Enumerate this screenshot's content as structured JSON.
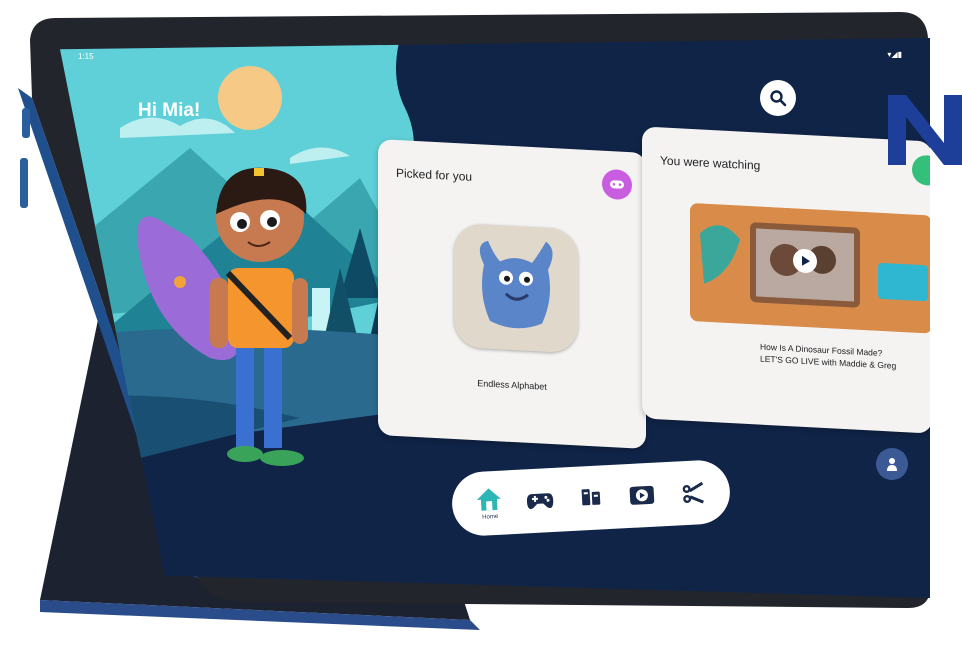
{
  "status_bar": {
    "time": "1:15",
    "icons": "▾◢▮"
  },
  "greeting": "Hi Mia!",
  "search_icon": "search-icon",
  "cards": {
    "picked": {
      "title": "Picked for you",
      "badge_icon": "gamepad-icon",
      "badge_color": "#c95de0",
      "app_name": "Endless Alphabet"
    },
    "watching": {
      "title": "You were watching",
      "badge_color": "#34c07a",
      "video_title_line1": "How Is A Dinosaur Fossil Made?",
      "video_title_line2": "LET'S GO LIVE with Maddie & Greg"
    }
  },
  "nav": {
    "items": [
      {
        "icon": "home-icon",
        "label": "Home",
        "active": true
      },
      {
        "icon": "gamepad-icon",
        "label": "",
        "active": false
      },
      {
        "icon": "books-icon",
        "label": "",
        "active": false
      },
      {
        "icon": "video-icon",
        "label": "",
        "active": false
      },
      {
        "icon": "scissors-icon",
        "label": "",
        "active": false
      }
    ]
  },
  "profile_icon": "kid-profile-icon",
  "colors": {
    "screen_bg": "#102448",
    "accent_teal": "#2db6b5",
    "card_bg": "#f4f3f1",
    "brand_blue": "#1d3f9a"
  }
}
